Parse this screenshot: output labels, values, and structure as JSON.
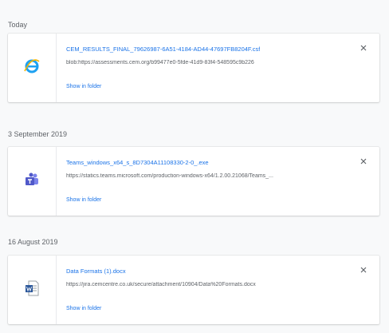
{
  "downloads": [
    {
      "date": "Today",
      "file_name": "CEM_RESULTS_FINAL_79626987-6A51-4184-AD44-47697FB8204F.csf",
      "url": "blob:https://assessments.cem.org/b99477e0-5fde-41d9-83f4-548595c9b226",
      "action": "Show in folder",
      "icon": "internet-explorer-icon"
    },
    {
      "date": "3 September 2019",
      "file_name": "Teams_windows_x64_s_8D7304A11108330-2-0_.exe",
      "url": "https://statics.teams.microsoft.com/production-windows-x64/1.2.00.21068/Teams_...",
      "action": "Show in folder",
      "icon": "microsoft-teams-icon"
    },
    {
      "date": "16 August 2019",
      "file_name": "Data Formats (1).docx",
      "url": "https://jira.cemcentre.co.uk/secure/attachment/10904/Data%20Formats.docx",
      "action": "Show in folder",
      "icon": "word-document-icon"
    }
  ],
  "colors": {
    "link": "#1a73e8",
    "muted": "#5f6368",
    "background": "#f8f9fa",
    "teams": "#5059c9",
    "word": "#2b579a",
    "ie": "#1ea1f1"
  }
}
